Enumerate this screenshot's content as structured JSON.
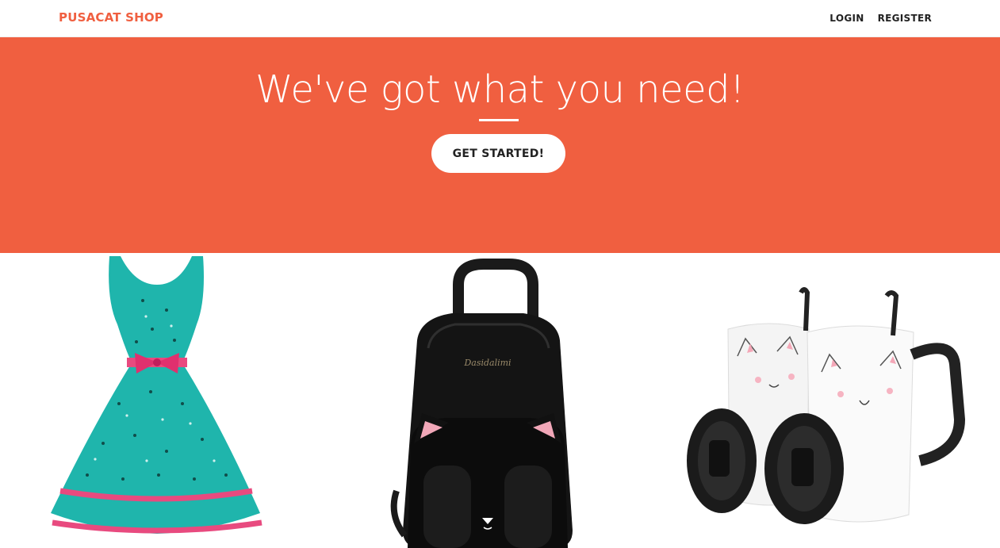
{
  "nav": {
    "brand": "PUSACAT SHOP",
    "links": [
      "LOGIN",
      "REGISTER"
    ]
  },
  "hero": {
    "title": "We've got what you need!",
    "cta_label": "GET STARTED!"
  },
  "products": [
    {
      "name": "dress-icon",
      "kind": "cat print teal dress with pink bow"
    },
    {
      "name": "backpack-icon",
      "kind": "black cat-ear backpack",
      "brand_text": "Dasidalimi"
    },
    {
      "name": "mugs-icon",
      "kind": "two cat mugs with lids and spoons"
    }
  ],
  "colors": {
    "accent": "#f05f40",
    "nav_text": "#222222",
    "hero_text": "#ffffff"
  }
}
